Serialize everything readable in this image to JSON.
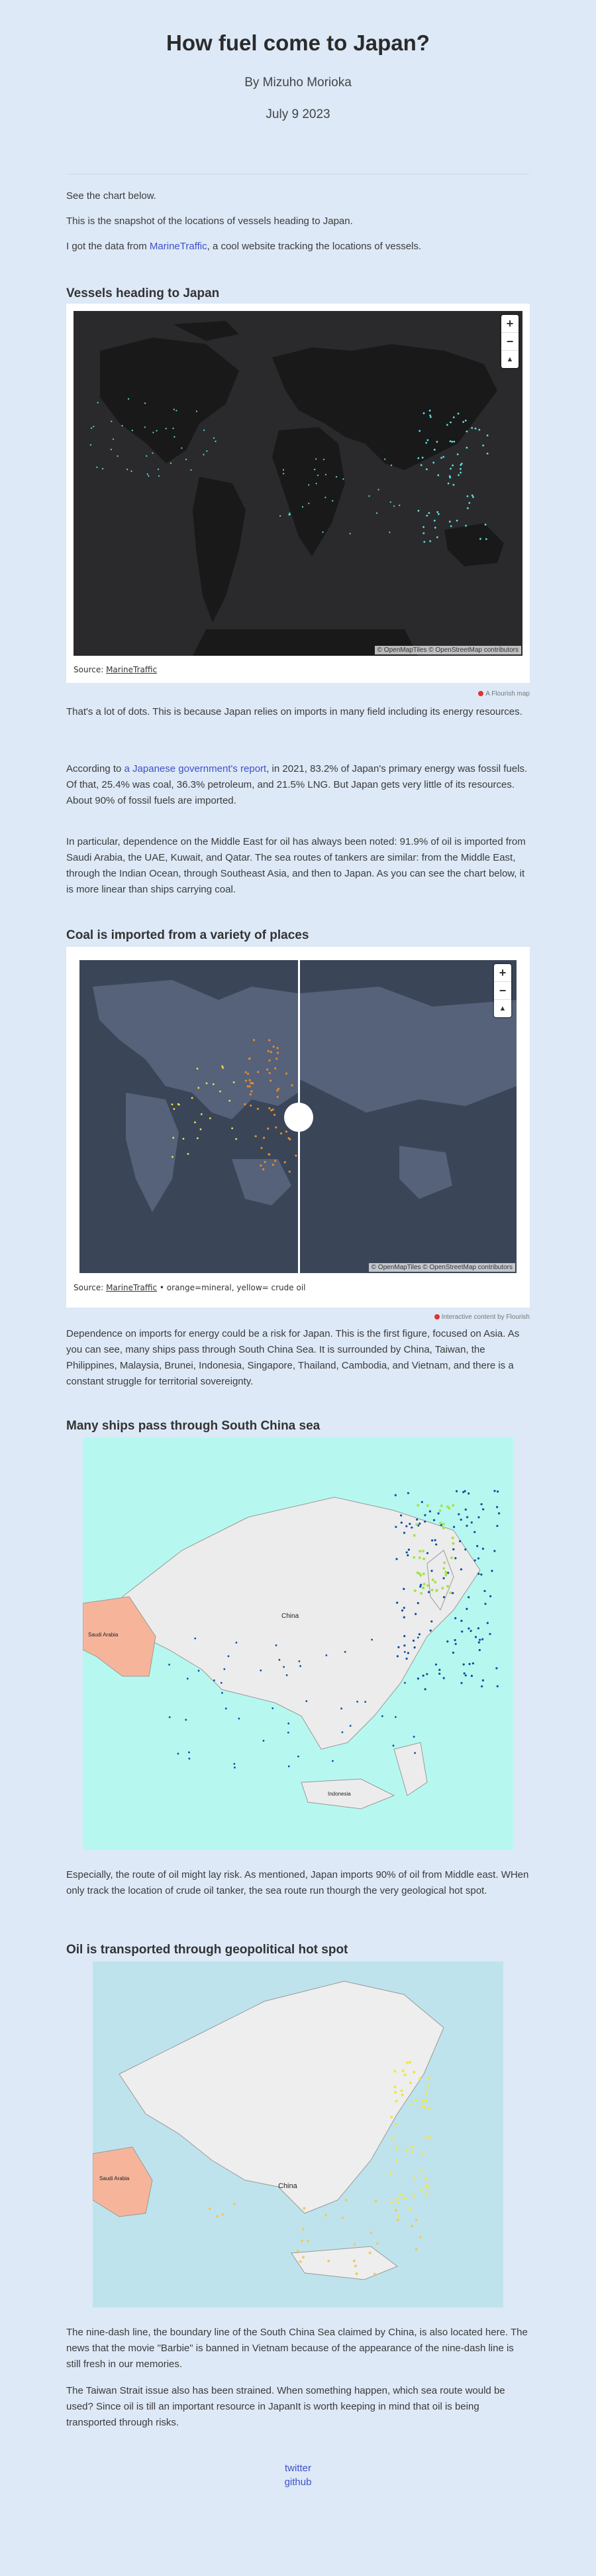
{
  "header": {
    "title": "How fuel come to Japan?",
    "byline": "By Mizuho Morioka",
    "date": "July 9 2023"
  },
  "intro": {
    "p1": "See the chart below.",
    "p2": "This is the snapshot of the locations of vessels heading to Japan.",
    "p3_before": "I got the data from ",
    "p3_link": "MarineTraffic",
    "p3_after": ", a cool website tracking the locations of vessels."
  },
  "section1": {
    "heading": "Vessels heading to Japan",
    "source_label": "Source: ",
    "source_link": "MarineTraffic",
    "attribution": "© OpenMapTiles © OpenStreetMap contributors",
    "flourish": "A Flourish map",
    "zoom_in": "+",
    "zoom_out": "−",
    "reset": "▲"
  },
  "body1": {
    "p1": "That's a lot of dots. This is because Japan relies on imports in many field including its energy resources.",
    "p2_before": "According to ",
    "p2_link": "a Japanese government's report",
    "p2_after": ", in 2021, 83.2% of Japan's primary energy was fossil fuels. Of that, 25.4% was coal, 36.3% petroleum, and 21.5% LNG. But Japan gets very little of its resources. About 90% of fossil fuels are imported.",
    "p3": "In particular, dependence on the Middle East for oil has always been noted: 91.9% of oil is imported from Saudi Arabia, the UAE, Kuwait, and Qatar. The sea routes of tankers are similar: from the Middle East, through the Indian Ocean, through Southeast Asia, and then to Japan. As you can see the chart below, it is more linear than ships carrying coal."
  },
  "section2": {
    "heading": "Coal is imported from a variety of places",
    "source_label": "Source: ",
    "source_link": "MarineTraffic",
    "source_after": " • orange=mineral, yellow= crude oil",
    "attribution": "© OpenMapTiles © OpenStreetMap contributors",
    "flourish": "Interactive content by Flourish",
    "zoom_in": "+",
    "zoom_out": "−",
    "reset": "▲"
  },
  "body2": {
    "p1": "Dependence on imports for energy could be a risk for Japan. This is the first figure, focused on Asia. As you can see, many ships pass through South China Sea. It is surrounded by China, Taiwan, the Philippines, Malaysia, Brunei, Indonesia, Singapore, Thailand, Cambodia, and Vietnam, and there is a constant struggle for territorial sovereignty."
  },
  "section3": {
    "heading": "Many ships pass through South China sea",
    "label_china": "China",
    "label_saudi": "Saudi Arabia",
    "label_indonesia": "Indonesia"
  },
  "body3": {
    "p1": "Especially, the route of oil might lay risk. As mentioned, Japan imports 90% of oil from Middle east. WHen only track the location of crude oil tanker, the sea route run thourgh the very geological hot spot."
  },
  "section4": {
    "heading": "Oil is transported through geopolitical hot spot",
    "label_china": "China",
    "label_saudi": "Saudi Arabia"
  },
  "body4": {
    "p1": "The nine-dash line, the boundary line of the South China Sea claimed by China, is also located here. The news that the movie \"Barbie\" is banned in Vietnam because of the appearance of the nine-dash line is still fresh in our memories.",
    "p2": "The Taiwan Strait issue also has been strained. When something happen, which sea route would be used? Since oil is till an important resource in JapanIt is worth keeping in mind that oil is being transported through risks."
  },
  "footer": {
    "twitter": "twitter",
    "github": "github"
  },
  "colors": {
    "background": "#dde9f7",
    "link": "#3f51c9",
    "vessel_dot": "#5ee0e0",
    "coal_dot": "#e58a2b",
    "oil_dot": "#f2e44a",
    "saudi_fill": "#f6b59a"
  }
}
